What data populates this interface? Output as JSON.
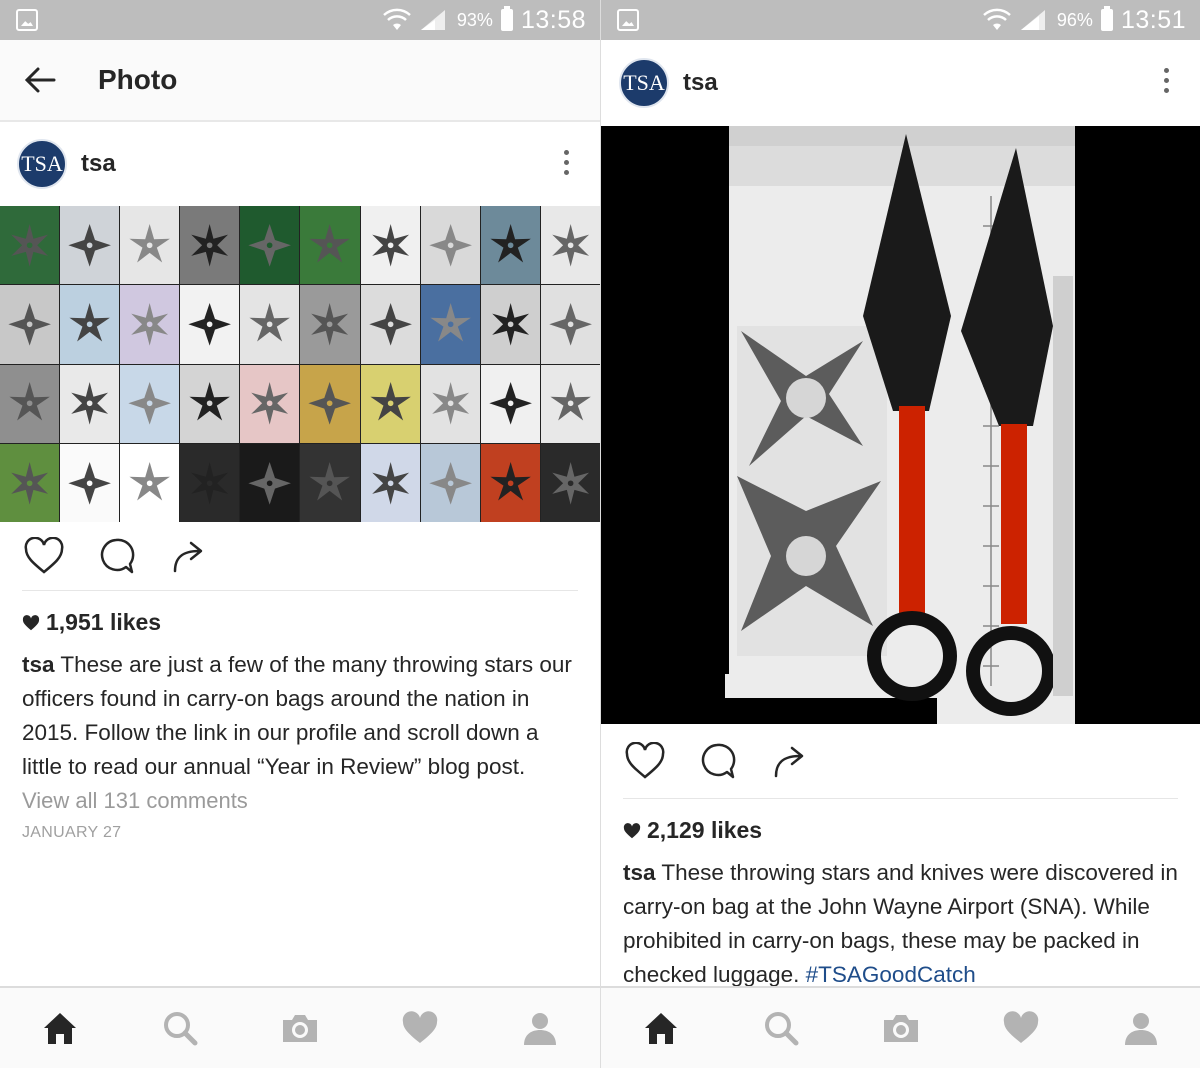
{
  "left": {
    "status": {
      "battery": "93%",
      "time": "13:58"
    },
    "appbar": {
      "title": "Photo"
    },
    "post": {
      "avatar_text": "TSA",
      "username": "tsa",
      "likes": "1,951 likes",
      "caption_user": "tsa",
      "caption_text": " These are just a few of the many throwing stars our officers found in carry-on bags around the nation in 2015. Follow the link in our profile and scroll down a little to read our annual “Year in Review” blog post.",
      "view_comments": "View all 131 comments",
      "date": "JANUARY 27"
    }
  },
  "right": {
    "status": {
      "battery": "96%",
      "time": "13:51"
    },
    "post": {
      "avatar_text": "TSA",
      "username": "tsa",
      "likes": "2,129 likes",
      "caption_user": "tsa",
      "caption_text": " These throwing stars and knives were discovered in carry-on bag at the John Wayne Airport (SNA). While prohibited in carry-on bags, these may be packed in checked luggage. ",
      "hashtag": "#TSAGoodCatch"
    }
  },
  "tabs": [
    "home-icon",
    "search-icon",
    "camera-icon",
    "heart-icon",
    "profile-icon"
  ],
  "colors": {
    "statusbar": "#bdbdbd",
    "avatar": "#1c3b6b",
    "hashtag": "#1f4d8a",
    "muted": "#9a9a9a"
  }
}
